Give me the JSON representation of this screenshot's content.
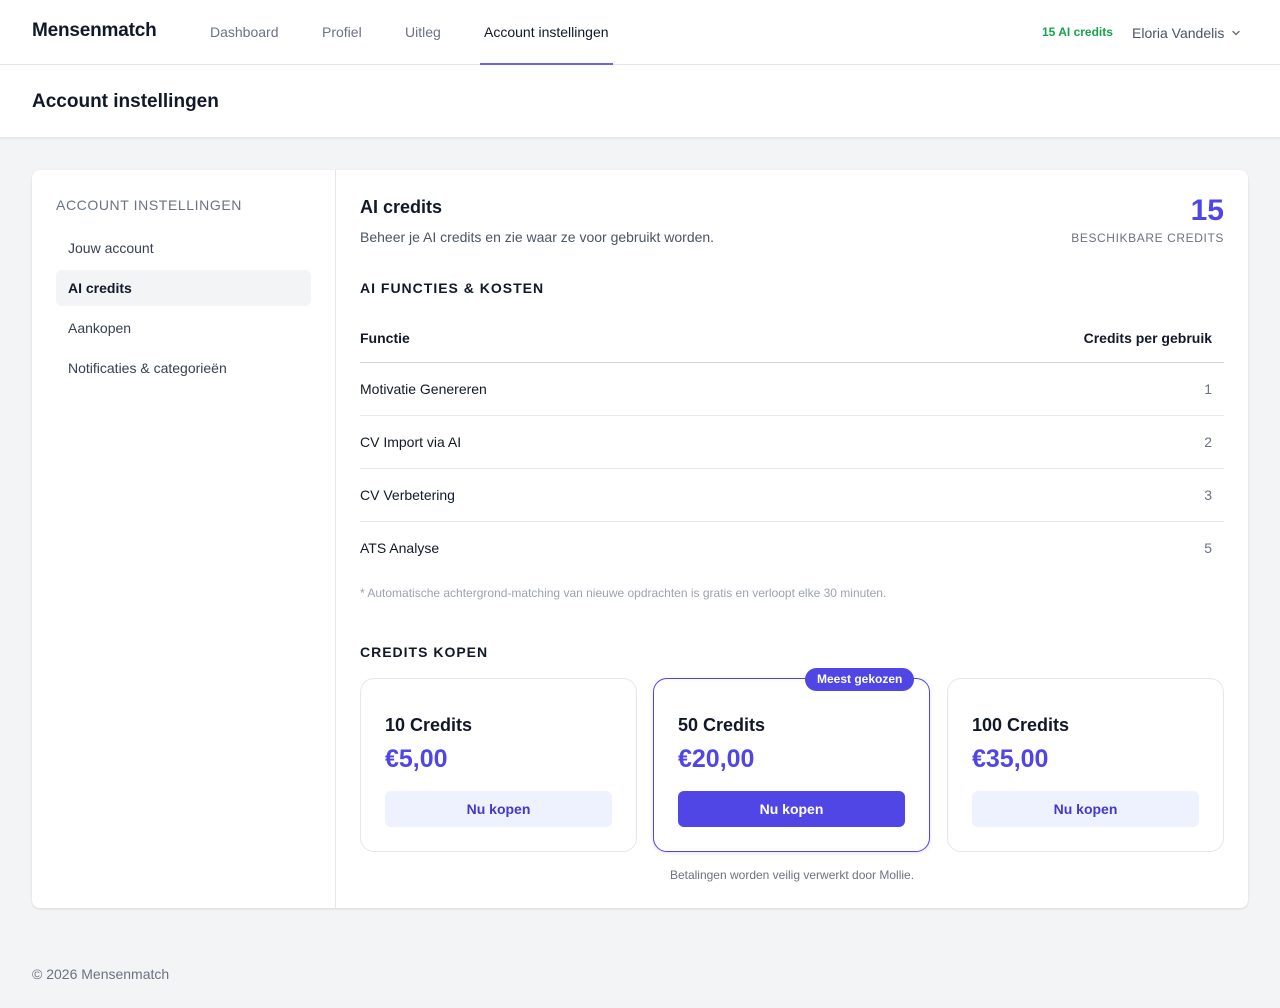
{
  "brand": "Mensenmatch",
  "nav": {
    "links": [
      {
        "label": "Dashboard"
      },
      {
        "label": "Profiel"
      },
      {
        "label": "Uitleg"
      },
      {
        "label": "Account instellingen"
      }
    ],
    "credits_badge": "15 AI credits",
    "user_name": "Eloria Vandelis"
  },
  "page_title": "Account instellingen",
  "sidebar": {
    "heading": "ACCOUNT INSTELLINGEN",
    "items": [
      {
        "label": "Jouw account"
      },
      {
        "label": "AI credits"
      },
      {
        "label": "Aankopen"
      },
      {
        "label": "Notificaties & categorieën"
      }
    ]
  },
  "section": {
    "title": "AI credits",
    "subtitle": "Beheer je AI credits en zie waar ze voor gebruikt worden.",
    "available_credits": "15",
    "available_label": "BESCHIKBARE CREDITS"
  },
  "functions": {
    "heading": "AI FUNCTIES & KOSTEN",
    "col_function": "Functie",
    "col_credits": "Credits per gebruik",
    "rows": [
      {
        "name": "Motivatie Genereren",
        "credits": "1"
      },
      {
        "name": "CV Import via AI",
        "credits": "2"
      },
      {
        "name": "CV Verbetering",
        "credits": "3"
      },
      {
        "name": "ATS Analyse",
        "credits": "5"
      }
    ],
    "footnote": "* Automatische achtergrond-matching van nieuwe opdrachten is gratis en verloopt elke 30 minuten."
  },
  "buy": {
    "heading": "CREDITS KOPEN",
    "popular_badge": "Meest gekozen",
    "plans": [
      {
        "name": "10 Credits",
        "price": "€5,00",
        "button": "Nu kopen"
      },
      {
        "name": "50 Credits",
        "price": "€20,00",
        "button": "Nu kopen"
      },
      {
        "name": "100 Credits",
        "price": "€35,00",
        "button": "Nu kopen"
      }
    ],
    "payment_note": "Betalingen worden veilig verwerkt door Mollie."
  },
  "footer": "© 2026 Mensenmatch",
  "colors": {
    "accent": "#4f46e5",
    "credits_green": "#16a34a",
    "nav_underline": "#6366f1"
  }
}
